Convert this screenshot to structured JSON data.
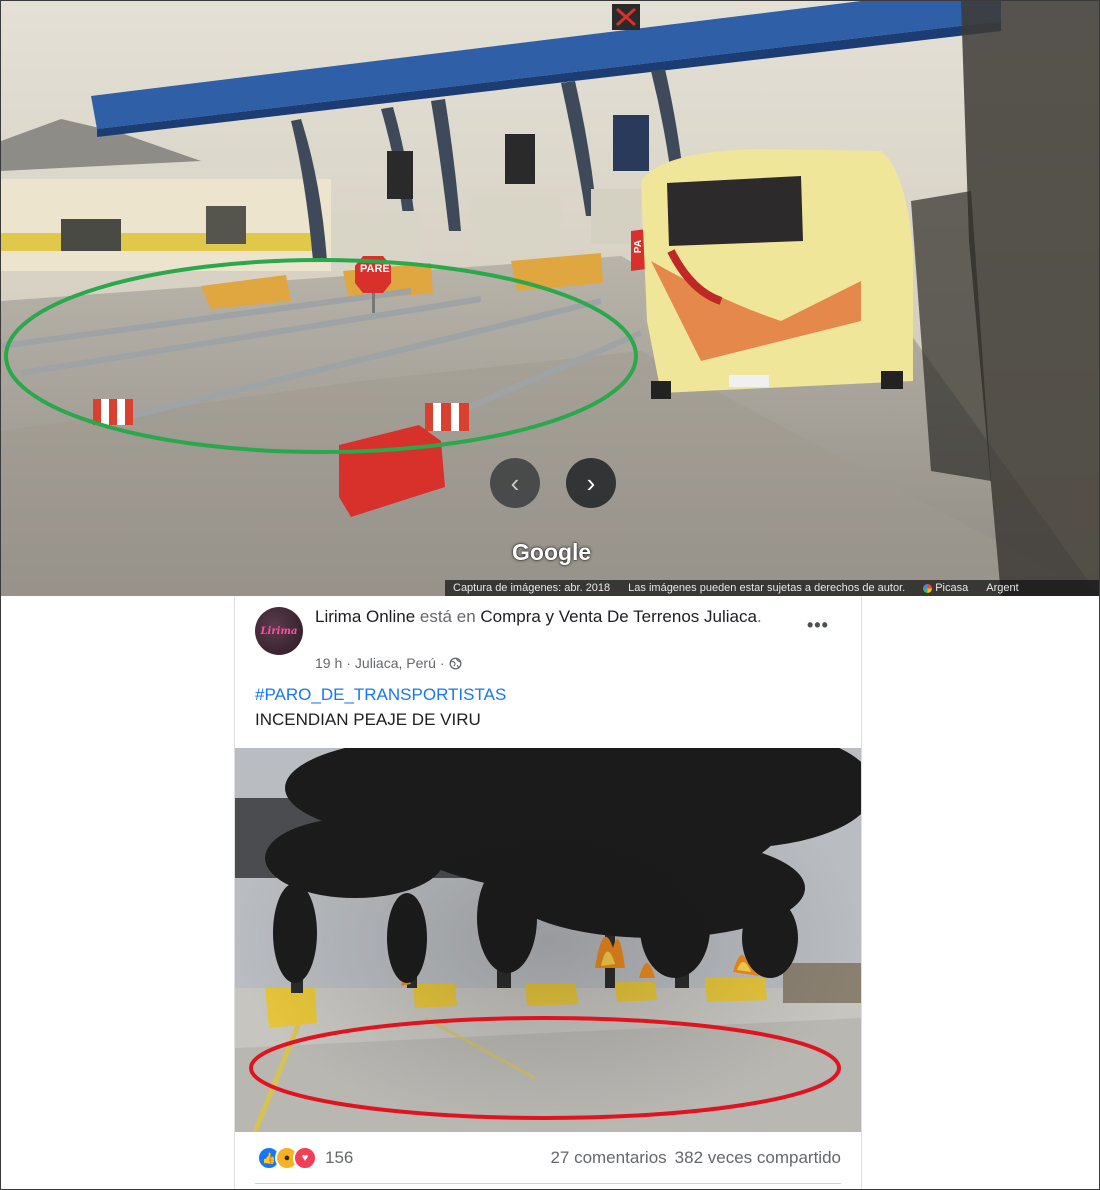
{
  "streetview": {
    "logo": "Google",
    "prev_icon": "chevron-left-icon",
    "next_icon": "chevron-right-icon",
    "signs": {
      "stop_left": "PARE",
      "stop_right": "PA"
    },
    "footer": {
      "capture_date": "Captura de imágenes: abr. 2018",
      "copyright": "Las imágenes pueden estar sujetas a derechos de autor.",
      "source": "Picasa",
      "region": "Argent"
    },
    "annotation_color": "#2aa84a"
  },
  "post": {
    "avatar_text": "Lirima",
    "author": "Lirima Online",
    "verb": " está en ",
    "group": "Compra y Venta De Terrenos Juliaca",
    "group_suffix": ".",
    "time": "19 h",
    "location": "Juliaca, Perú",
    "separator": "·",
    "privacy_icon": "globe-icon",
    "more_icon": "•••",
    "hashtag": "#PARO_DE_TRANSPORTISTAS",
    "text": "INCENDIAN PEAJE DE VIRU",
    "reactions": {
      "icons": [
        "like-icon",
        "wow-icon",
        "love-icon"
      ],
      "count": "156"
    },
    "comments": "27 comentarios",
    "shares": "382 veces compartido",
    "annotation_color": "#e0141e",
    "link_color": "#1877f2"
  }
}
